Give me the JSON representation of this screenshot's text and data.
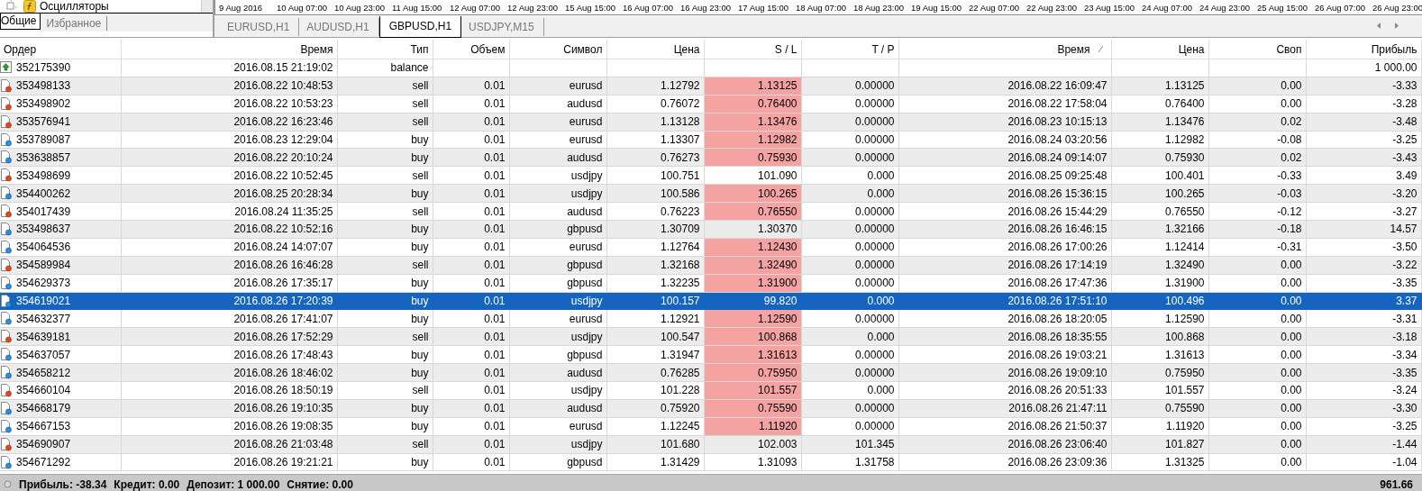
{
  "navigator": {
    "tree_item": "Осцилляторы",
    "tabs": [
      {
        "label": "Общие",
        "selected": true
      },
      {
        "label": "Избранное",
        "selected": false
      }
    ]
  },
  "timeline": [
    "9 Aug 2016",
    "10 Aug 07:00",
    "10 Aug 23:00",
    "11 Aug 15:00",
    "12 Aug 07:00",
    "12 Aug 23:00",
    "15 Aug 15:00",
    "16 Aug 07:00",
    "16 Aug 23:00",
    "17 Aug 15:00",
    "18 Aug 07:00",
    "18 Aug 23:00",
    "19 Aug 15:00",
    "22 Aug 07:00",
    "22 Aug 23:00",
    "23 Aug 15:00",
    "24 Aug 07:00",
    "24 Aug 23:00",
    "25 Aug 15:00",
    "26 Aug 07:00",
    "26 Aug 23:00"
  ],
  "chart_tabs": [
    {
      "label": "EURUSD,H1",
      "selected": false
    },
    {
      "label": "AUDUSD,H1",
      "selected": false
    },
    {
      "label": "GBPUSD,H1",
      "selected": true
    },
    {
      "label": "USDJPY,M15",
      "selected": false
    }
  ],
  "table": {
    "columns": [
      {
        "label": "Ордер",
        "sorted": false
      },
      {
        "label": "Время",
        "sorted": false
      },
      {
        "label": "Тип",
        "sorted": false
      },
      {
        "label": "Объем",
        "sorted": false
      },
      {
        "label": "Символ",
        "sorted": false
      },
      {
        "label": "Цена",
        "sorted": false
      },
      {
        "label": "S / L",
        "sorted": false
      },
      {
        "label": "T / P",
        "sorted": false
      },
      {
        "label": "Время",
        "sorted": true
      },
      {
        "label": "Цена",
        "sorted": false
      },
      {
        "label": "Своп",
        "sorted": false
      },
      {
        "label": "Прибыль",
        "sorted": false
      }
    ],
    "rows": [
      {
        "kind": "balance",
        "selected": false,
        "sl_hit": false,
        "cells": [
          "352175390",
          "2016.08.15 21:19:02",
          "balance",
          null,
          null,
          null,
          null,
          null,
          null,
          null,
          null,
          "1 000.00"
        ]
      },
      {
        "kind": "sell",
        "selected": false,
        "sl_hit": true,
        "cells": [
          "353498133",
          "2016.08.22 10:48:53",
          "sell",
          "0.01",
          "eurusd",
          "1.12792",
          "1.13125",
          "0.00000",
          "2016.08.22 16:09:47",
          "1.13125",
          "0.00",
          "-3.33"
        ]
      },
      {
        "kind": "sell",
        "selected": false,
        "sl_hit": true,
        "cells": [
          "353498902",
          "2016.08.22 10:53:23",
          "sell",
          "0.01",
          "audusd",
          "0.76072",
          "0.76400",
          "0.00000",
          "2016.08.22 17:58:04",
          "0.76400",
          "0.00",
          "-3.28"
        ]
      },
      {
        "kind": "sell",
        "selected": false,
        "sl_hit": true,
        "cells": [
          "353576941",
          "2016.08.22 16:23:46",
          "sell",
          "0.01",
          "eurusd",
          "1.13128",
          "1.13476",
          "0.00000",
          "2016.08.23 10:15:13",
          "1.13476",
          "0.02",
          "-3.48"
        ]
      },
      {
        "kind": "buy",
        "selected": false,
        "sl_hit": true,
        "cells": [
          "353789087",
          "2016.08.23 12:29:04",
          "buy",
          "0.01",
          "eurusd",
          "1.13307",
          "1.12982",
          "0.00000",
          "2016.08.24 03:20:56",
          "1.12982",
          "-0.08",
          "-3.25"
        ]
      },
      {
        "kind": "buy",
        "selected": false,
        "sl_hit": true,
        "cells": [
          "353638857",
          "2016.08.22 20:10:24",
          "buy",
          "0.01",
          "audusd",
          "0.76273",
          "0.75930",
          "0.00000",
          "2016.08.24 09:14:07",
          "0.75930",
          "0.02",
          "-3.43"
        ]
      },
      {
        "kind": "sell",
        "selected": false,
        "sl_hit": false,
        "cells": [
          "353498699",
          "2016.08.22 10:52:45",
          "sell",
          "0.01",
          "usdjpy",
          "100.751",
          "101.090",
          "0.000",
          "2016.08.25 09:25:48",
          "100.401",
          "-0.33",
          "3.49"
        ]
      },
      {
        "kind": "buy",
        "selected": false,
        "sl_hit": true,
        "cells": [
          "354400262",
          "2016.08.25 20:28:34",
          "buy",
          "0.01",
          "usdjpy",
          "100.586",
          "100.265",
          "0.000",
          "2016.08.26 15:36:15",
          "100.265",
          "-0.03",
          "-3.20"
        ]
      },
      {
        "kind": "sell",
        "selected": false,
        "sl_hit": true,
        "cells": [
          "354017439",
          "2016.08.24 11:35:25",
          "sell",
          "0.01",
          "audusd",
          "0.76223",
          "0.76550",
          "0.00000",
          "2016.08.26 15:44:29",
          "0.76550",
          "-0.12",
          "-3.27"
        ]
      },
      {
        "kind": "buy",
        "selected": false,
        "sl_hit": false,
        "cells": [
          "353498637",
          "2016.08.22 10:52:16",
          "buy",
          "0.01",
          "gbpusd",
          "1.30709",
          "1.30370",
          "0.00000",
          "2016.08.26 16:46:15",
          "1.32166",
          "-0.18",
          "14.57"
        ]
      },
      {
        "kind": "buy",
        "selected": false,
        "sl_hit": true,
        "cells": [
          "354064536",
          "2016.08.24 14:07:07",
          "buy",
          "0.01",
          "eurusd",
          "1.12764",
          "1.12430",
          "0.00000",
          "2016.08.26 17:00:26",
          "1.12414",
          "-0.31",
          "-3.50"
        ]
      },
      {
        "kind": "sell",
        "selected": false,
        "sl_hit": true,
        "cells": [
          "354589984",
          "2016.08.26 16:46:28",
          "sell",
          "0.01",
          "gbpusd",
          "1.32168",
          "1.32490",
          "0.00000",
          "2016.08.26 17:14:19",
          "1.32490",
          "0.00",
          "-3.22"
        ]
      },
      {
        "kind": "buy",
        "selected": false,
        "sl_hit": true,
        "cells": [
          "354629373",
          "2016.08.26 17:35:17",
          "buy",
          "0.01",
          "gbpusd",
          "1.32235",
          "1.31900",
          "0.00000",
          "2016.08.26 17:47:36",
          "1.31900",
          "0.00",
          "-3.35"
        ]
      },
      {
        "kind": "buy",
        "selected": true,
        "sl_hit": false,
        "cells": [
          "354619021",
          "2016.08.26 17:20:39",
          "buy",
          "0.01",
          "usdjpy",
          "100.157",
          "99.820",
          "0.000",
          "2016.08.26 17:51:10",
          "100.496",
          "0.00",
          "3.37"
        ]
      },
      {
        "kind": "buy",
        "selected": false,
        "sl_hit": true,
        "cells": [
          "354632377",
          "2016.08.26 17:41:07",
          "buy",
          "0.01",
          "eurusd",
          "1.12921",
          "1.12590",
          "0.00000",
          "2016.08.26 18:20:05",
          "1.12590",
          "0.00",
          "-3.31"
        ]
      },
      {
        "kind": "sell",
        "selected": false,
        "sl_hit": true,
        "cells": [
          "354639181",
          "2016.08.26 17:52:29",
          "sell",
          "0.01",
          "usdjpy",
          "100.547",
          "100.868",
          "0.000",
          "2016.08.26 18:35:55",
          "100.868",
          "0.00",
          "-3.18"
        ]
      },
      {
        "kind": "buy",
        "selected": false,
        "sl_hit": true,
        "cells": [
          "354637057",
          "2016.08.26 17:48:43",
          "buy",
          "0.01",
          "gbpusd",
          "1.31947",
          "1.31613",
          "0.00000",
          "2016.08.26 19:03:21",
          "1.31613",
          "0.00",
          "-3.34"
        ]
      },
      {
        "kind": "buy",
        "selected": false,
        "sl_hit": true,
        "cells": [
          "354658212",
          "2016.08.26 18:46:02",
          "buy",
          "0.01",
          "audusd",
          "0.76285",
          "0.75950",
          "0.00000",
          "2016.08.26 19:09:10",
          "0.75950",
          "0.00",
          "-3.35"
        ]
      },
      {
        "kind": "sell",
        "selected": false,
        "sl_hit": true,
        "cells": [
          "354660104",
          "2016.08.26 18:50:19",
          "sell",
          "0.01",
          "usdjpy",
          "101.228",
          "101.557",
          "0.000",
          "2016.08.26 20:51:33",
          "101.557",
          "0.00",
          "-3.24"
        ]
      },
      {
        "kind": "buy",
        "selected": false,
        "sl_hit": true,
        "cells": [
          "354668179",
          "2016.08.26 19:10:35",
          "buy",
          "0.01",
          "audusd",
          "0.75920",
          "0.75590",
          "0.00000",
          "2016.08.26 21:47:11",
          "0.75590",
          "0.00",
          "-3.30"
        ]
      },
      {
        "kind": "buy",
        "selected": false,
        "sl_hit": true,
        "cells": [
          "354667153",
          "2016.08.26 19:08:35",
          "buy",
          "0.01",
          "eurusd",
          "1.12245",
          "1.11920",
          "0.00000",
          "2016.08.26 21:50:37",
          "1.11920",
          "0.00",
          "-3.25"
        ]
      },
      {
        "kind": "sell",
        "selected": false,
        "sl_hit": false,
        "cells": [
          "354690907",
          "2016.08.26 21:03:48",
          "sell",
          "0.01",
          "usdjpy",
          "101.680",
          "102.003",
          "101.345",
          "2016.08.26 23:06:40",
          "101.827",
          "0.00",
          "-1.44"
        ]
      },
      {
        "kind": "buy",
        "selected": false,
        "sl_hit": false,
        "cells": [
          "354671292",
          "2016.08.26 19:21:21",
          "buy",
          "0.01",
          "gbpusd",
          "1.31429",
          "1.31093",
          "1.31758",
          "2016.08.26 23:09:36",
          "1.31325",
          "0.00",
          "-1.04"
        ]
      }
    ]
  },
  "status_bar": {
    "items": [
      "Прибыль: -38.34",
      "Кредит: 0.00",
      "Депозит: 1 000.00",
      "Снятие: 0.00"
    ],
    "total": "961.66"
  }
}
